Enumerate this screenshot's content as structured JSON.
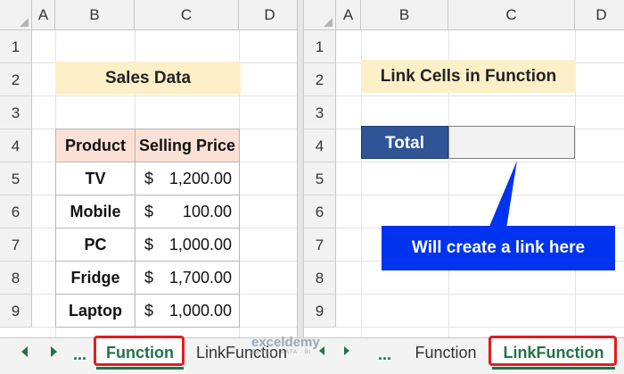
{
  "left_sheet": {
    "columns": [
      "A",
      "B",
      "C",
      "D"
    ],
    "rows": [
      "1",
      "2",
      "3",
      "4",
      "5",
      "6",
      "7",
      "8",
      "9"
    ],
    "title": "Sales Data",
    "table": {
      "headers": [
        "Product",
        "Selling Price"
      ],
      "rows": [
        {
          "product": "TV",
          "currency": "$",
          "amount": "1,200.00"
        },
        {
          "product": "Mobile",
          "currency": "$",
          "amount": "100.00"
        },
        {
          "product": "PC",
          "currency": "$",
          "amount": "1,000.00"
        },
        {
          "product": "Fridge",
          "currency": "$",
          "amount": "1,700.00"
        },
        {
          "product": "Laptop",
          "currency": "$",
          "amount": "1,000.00"
        }
      ]
    }
  },
  "right_sheet": {
    "columns": [
      "A",
      "B",
      "C",
      "D"
    ],
    "rows": [
      "1",
      "2",
      "3",
      "4",
      "5",
      "6",
      "7",
      "8",
      "9"
    ],
    "title": "Link Cells in Function",
    "total_label": "Total",
    "total_value": "",
    "callout": "Will create a link here"
  },
  "tabs_left": {
    "ellipsis": "...",
    "active": "Function",
    "other": "LinkFunction"
  },
  "tabs_right": {
    "ellipsis": "...",
    "other": "Function",
    "active": "LinkFunction"
  },
  "watermark": {
    "name": "exceldemy",
    "tagline": "EXCEL · DATA · BI"
  },
  "colors": {
    "accent_green": "#217346",
    "total_blue": "#2f5597",
    "callout_blue": "#0033ee",
    "highlight_red": "#e21d1d"
  }
}
